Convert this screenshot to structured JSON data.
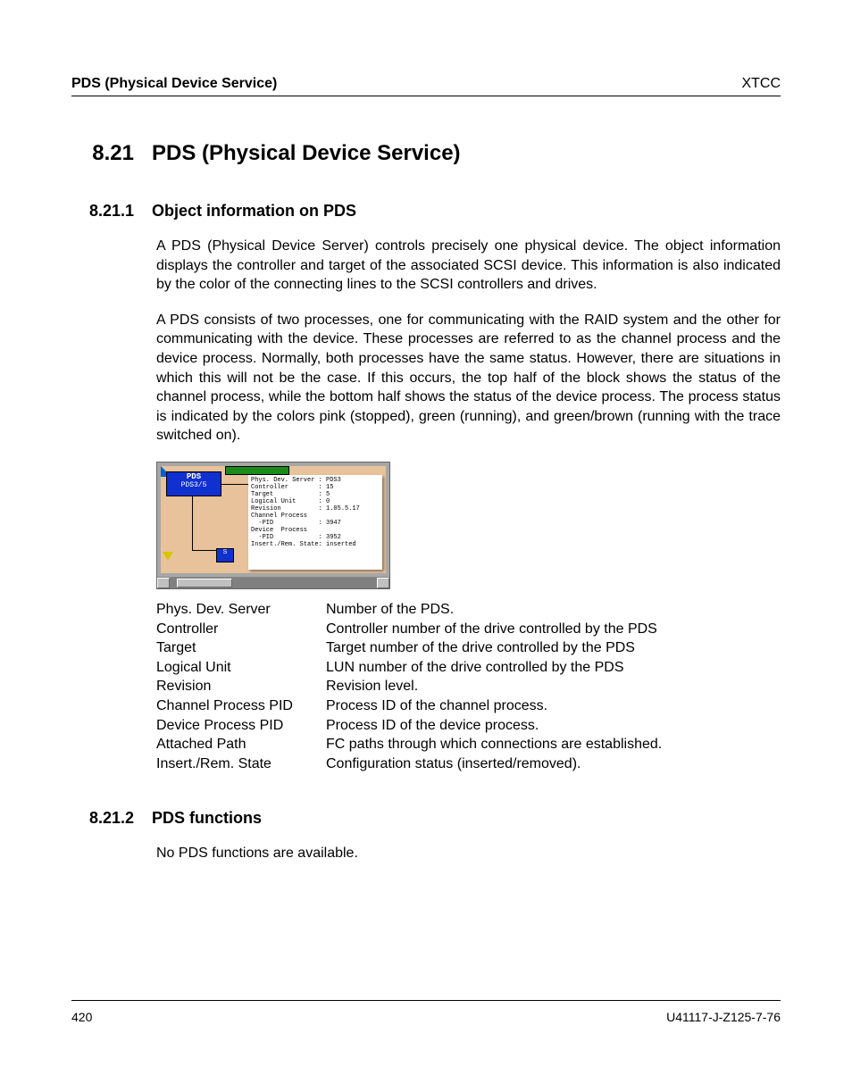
{
  "header": {
    "left": "PDS (Physical Device Service)",
    "right": "XTCC"
  },
  "section": {
    "number": "8.21",
    "title": "PDS (Physical Device Service)"
  },
  "sub1": {
    "number": "8.21.1",
    "title": "Object information on PDS",
    "para1": "A PDS (Physical Device Server) controls precisely one physical device. The object information displays the controller and target of the associated SCSI device. This information is also indicated by the color of the connecting lines to the SCSI controllers and drives.",
    "para2": "A PDS consists of two processes, one for communicating with the RAID system and the other for communicating with the device. These processes are referred to as the channel process and the device process. Normally, both processes have the same status. However, there are situations in which this will not be the case. If this occurs, the top half of the block shows the status of the channel process, while the bottom half shows the status of the device process. The process status is indicated by the colors pink (stopped), green (running), and green/brown (running with the trace switched on)."
  },
  "diagram": {
    "pds_label_top": "PDS",
    "pds_label_bottom": "PDS3/5",
    "small_box": "S",
    "tooltip_rows": [
      "Phys. Dev. Server : PDS3",
      "Controller        : 15",
      "Target            : 5",
      "Logical Unit      : 0",
      "Revision          : 1.05.5.17",
      "Channel Process",
      "  -PID            : 3947",
      "Device  Process",
      "  -PID            : 3952",
      "Insert./Rem. State: inserted"
    ]
  },
  "definitions": [
    {
      "term": "Phys. Dev. Server",
      "desc": "Number of the PDS."
    },
    {
      "term": "Controller",
      "desc": "Controller number of the drive controlled by the PDS"
    },
    {
      "term": "Target",
      "desc": "Target number of the drive controlled by the PDS"
    },
    {
      "term": "Logical Unit",
      "desc": "LUN number of the drive controlled by the PDS"
    },
    {
      "term": "Revision",
      "desc": "Revision level."
    },
    {
      "term": "Channel Process PID",
      "desc": "Process ID of the channel process."
    },
    {
      "term": "Device Process PID",
      "desc": "Process ID of the device process."
    },
    {
      "term": "Attached Path",
      "desc": "FC paths through which connections are established."
    },
    {
      "term": "Insert./Rem. State",
      "desc": "Configuration status (inserted/removed)."
    }
  ],
  "sub2": {
    "number": "8.21.2",
    "title": "PDS functions",
    "para1": "No PDS functions are available."
  },
  "footer": {
    "page": "420",
    "doc": "U41117-J-Z125-7-76"
  }
}
